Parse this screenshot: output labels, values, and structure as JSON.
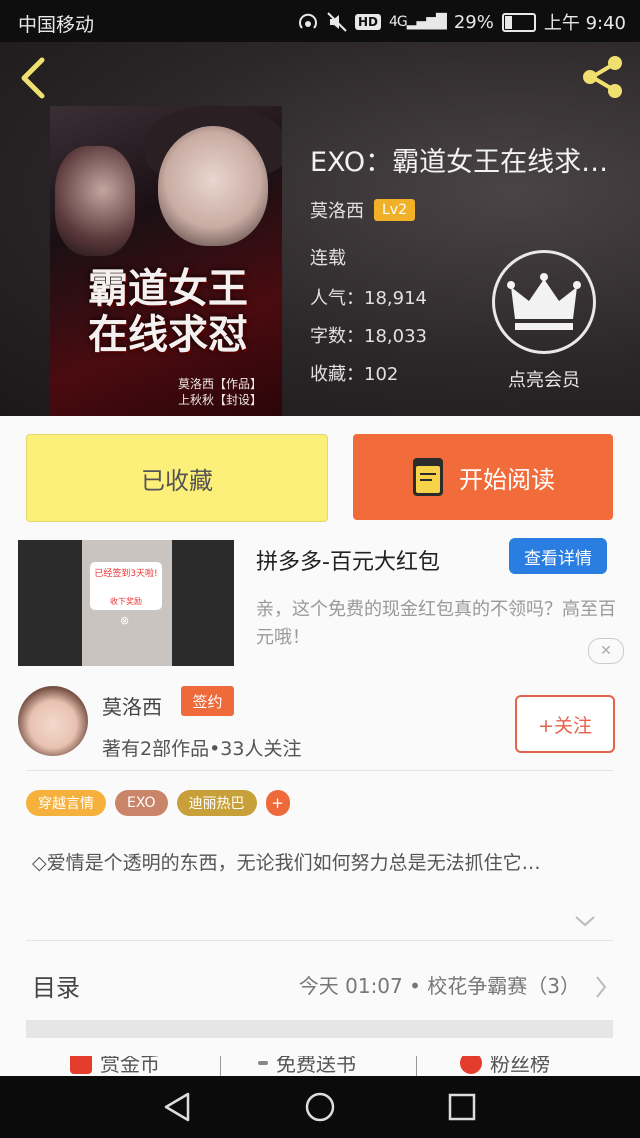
{
  "status_bar": {
    "carrier": "中国移动",
    "hd": "HD",
    "network": "4G",
    "battery_percent": "29%",
    "battery_level": 0.29,
    "time": "上午 9:40"
  },
  "book": {
    "title": "EXO：霸道女王在线求…",
    "author": "莫洛西",
    "author_level": "Lv2",
    "status": "连载",
    "popularity": "人气：18,914",
    "word_count": "字数：18,033",
    "favorites": "收藏：102",
    "vip_label": "点亮会员",
    "cover": {
      "title_line1": "霸道女王",
      "title_line2": "在线求怼",
      "credit_line1": "莫洛西【作品】",
      "credit_line2": "上秋秋【封设】"
    }
  },
  "actions": {
    "favorited_label": "已收藏",
    "read_label": "开始阅读"
  },
  "ad": {
    "title": "拼多多-百元大红包",
    "detail_label": "查看详情",
    "description": "亲，这个免费的现金红包真的不领吗？高至百元哦！",
    "close_symbol": "✕",
    "image_popup_title": "已经签到3天啦!",
    "image_popup_button": "收下奖励",
    "image_popup_close": "⊗"
  },
  "author": {
    "name": "莫洛西",
    "badge": "签约",
    "stats": "著有2部作品•33人关注",
    "follow_label": "+关注"
  },
  "tags": [
    {
      "label": "穿越言情",
      "color": "#f5b13c"
    },
    {
      "label": "EXO",
      "color": "#c98469"
    },
    {
      "label": "迪丽热巴",
      "color": "#c8a03a"
    },
    {
      "label": "+",
      "color": "#ef6a3a"
    }
  ],
  "synopsis": "◇爱情是个透明的东西，无论我们如何努力总是无法抓住它…",
  "toc": {
    "label": "目录",
    "latest": "今天 01:07 • 校花争霸赛（3）"
  },
  "bottom_tabs": [
    {
      "label": "赏金币",
      "icon": "gift-icon",
      "color": "#e33c2c"
    },
    {
      "label": "免费送书",
      "icon": "book-icon",
      "color": "#888888"
    },
    {
      "label": "粉丝榜",
      "icon": "trophy-icon",
      "color": "#e33c2c"
    }
  ],
  "colors": {
    "accent_orange": "#f26b3a",
    "favorite_yellow": "#fdf07a",
    "link_blue": "#2a7de1",
    "level_gold": "#f0b028"
  }
}
